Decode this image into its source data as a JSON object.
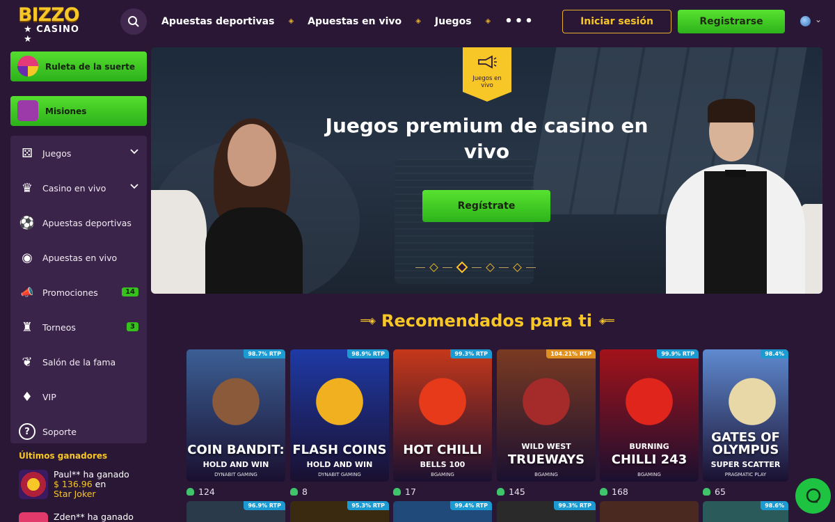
{
  "header": {
    "logo_top": "BIZZO",
    "logo_bottom": "★ CASINO ★",
    "nav": [
      "Apuestas deportivas",
      "Apuestas en vivo",
      "Juegos"
    ],
    "nav_separator": "◈",
    "more": "•••",
    "login_label": "Iniciar sesión",
    "register_label": "Registrarse",
    "lang_chevron": "⌄"
  },
  "sidebar": {
    "wheel_label": "Ruleta de la suerte",
    "missions_label": "Misiones",
    "items": [
      {
        "label": "Juegos",
        "icon": "slots-icon",
        "glyph": "⚄",
        "chevron": "⌄"
      },
      {
        "label": "Casino en vivo",
        "icon": "live-casino-icon",
        "glyph": "♛",
        "chevron": "⌄"
      },
      {
        "label": "Apuestas deportivas",
        "icon": "soccer-ball-icon",
        "glyph": "⚽"
      },
      {
        "label": "Apuestas en vivo",
        "icon": "live-broadcast-icon",
        "glyph": "◉"
      },
      {
        "label": "Promociones",
        "icon": "megaphone-icon",
        "glyph": "📣",
        "badge": "14"
      },
      {
        "label": "Torneos",
        "icon": "podium-icon",
        "glyph": "♜",
        "badge": "3"
      },
      {
        "label": "Salón de la fama",
        "icon": "laurel-icon",
        "glyph": "❦"
      },
      {
        "label": "VIP",
        "icon": "diamond-icon",
        "glyph": "♦"
      },
      {
        "label": "Soporte",
        "icon": "help-icon",
        "glyph": "?"
      }
    ],
    "winners_title": "Últimos ganadores",
    "winners": [
      {
        "prefix": "Paul** ha ganado",
        "amount": "$ 136.96",
        "en": " en",
        "game": "Star Joker"
      },
      {
        "prefix": "Zden** ha ganado",
        "amount": "",
        "en": "",
        "game": ""
      }
    ]
  },
  "hero": {
    "badge_text": "Juegos en vivo",
    "badge_icon": "megaphone-icon",
    "title": "Juegos premium de casino en vivo",
    "cta_label": "Regístrate",
    "active_slide": 1,
    "slide_count": 4
  },
  "recommended": {
    "title": "Recomendados para ti",
    "deco_left": "══◈",
    "deco_right": "◈══",
    "games": [
      {
        "name": "COIN BANDIT:",
        "sub": "HOLD AND WIN",
        "provider": "DYNABIT GAMING",
        "rtp": "98.7% RTP",
        "players": "124",
        "bg": "#3b5f94",
        "art": "#8a5a3a",
        "hot": false
      },
      {
        "name": "FLASH COINS",
        "sub": "HOLD AND WIN",
        "provider": "DYNABIT GAMING",
        "rtp": "98.9% RTP",
        "players": "8",
        "bg": "#1e3aa5",
        "art": "#f0b020",
        "hot": false
      },
      {
        "name": "HOT CHILLI",
        "sub": "BELLS 100",
        "provider": "BGAMING",
        "rtp": "99.3% RTP",
        "players": "17",
        "bg": "#c5381a",
        "art": "#e63a1b",
        "hot": false
      },
      {
        "name": "TRUEWAYS",
        "sub": "WILD WEST",
        "provider": "BGAMING",
        "rtp": "104.21% RTP",
        "players": "145",
        "bg": "#7a3a22",
        "art": "#a52a2a",
        "hot": true
      },
      {
        "name": "CHILLI 243",
        "sub": "BURNING",
        "provider": "BGAMING",
        "rtp": "99.9% RTP",
        "players": "168",
        "bg": "#a3121a",
        "art": "#e0251c",
        "hot": false
      },
      {
        "name": "GATES OF OLYMPUS",
        "sub": "SUPER SCATTER",
        "provider": "PRAGMATIC PLAY",
        "rtp": "98.4%",
        "players": "65",
        "bg": "#5f8ad0",
        "art": "#e8d8a8",
        "hot": false
      }
    ],
    "row2_rtp": [
      "96.9% RTP",
      "95.3% RTP",
      "99.4% RTP",
      "99.3% RTP",
      "",
      "98.6%"
    ]
  },
  "colors": {
    "background": "#2a1736",
    "accent_gold": "#f7c627",
    "accent_green": "#36c11c"
  }
}
